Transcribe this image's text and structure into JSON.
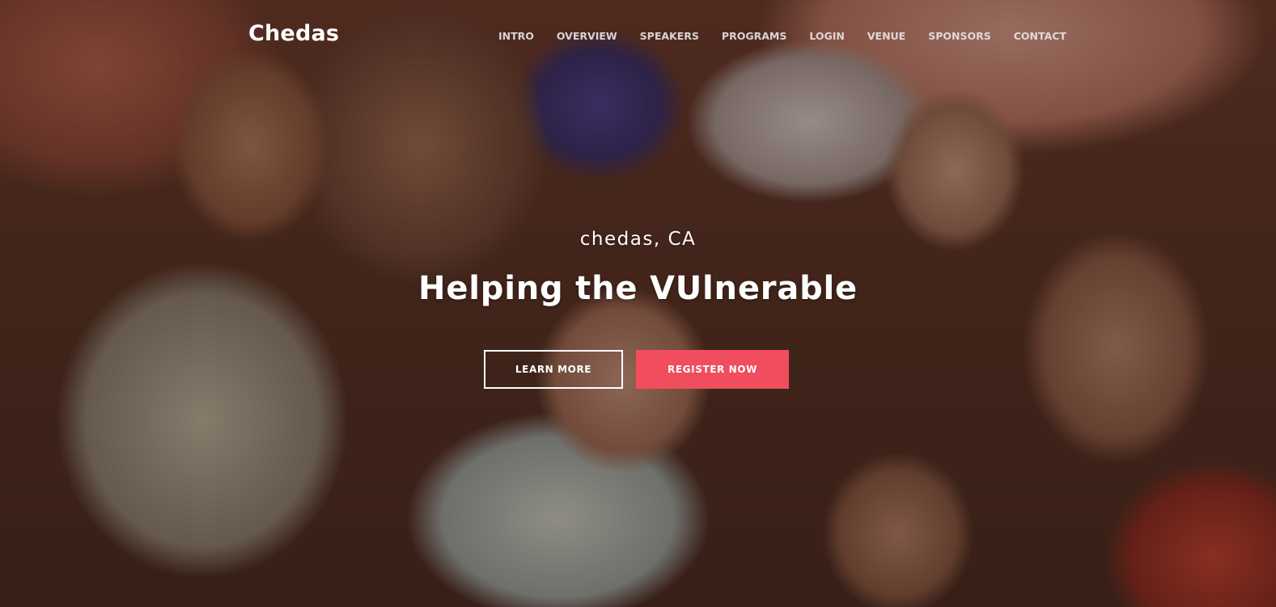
{
  "brand": {
    "name": "Chedas"
  },
  "nav": {
    "items": [
      {
        "label": "INTRO"
      },
      {
        "label": "OVERVIEW"
      },
      {
        "label": "SPEAKERS"
      },
      {
        "label": "PROGRAMS"
      },
      {
        "label": "LOGIN"
      },
      {
        "label": "VENUE"
      },
      {
        "label": "SPONSORS"
      },
      {
        "label": "CONTACT"
      }
    ]
  },
  "hero": {
    "location": "chedas, CA",
    "headline": "Helping the VUlnerable",
    "learn_more_label": "LEARN MORE",
    "register_label": "REGISTER NOW",
    "image": "children-smiling-photo"
  },
  "colors": {
    "accent": "#f04d5f",
    "text": "#ffffff"
  }
}
